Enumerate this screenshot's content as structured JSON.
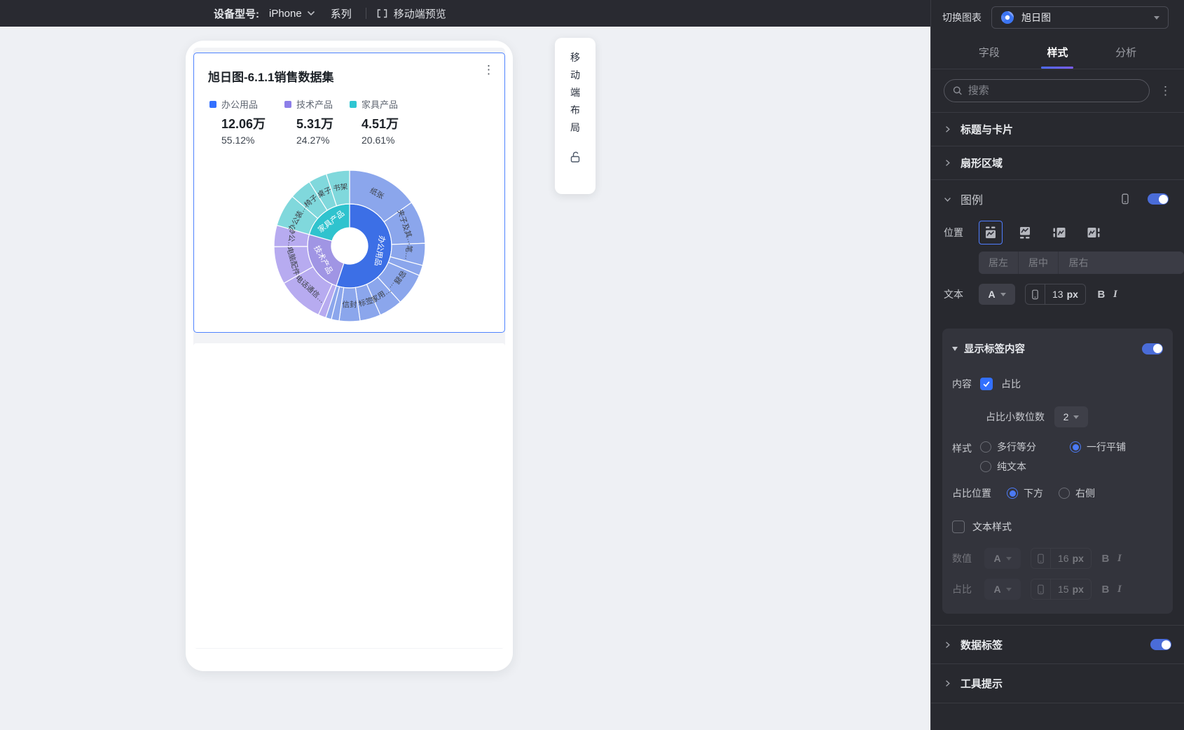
{
  "topbar": {
    "device_label": "设备型号:",
    "device_value": "iPhone",
    "series_label": "系列",
    "preview_label": "移动端预览"
  },
  "switcher": {
    "label": "切换图表",
    "value": "旭日图"
  },
  "tabs": [
    {
      "label": "字段"
    },
    {
      "label": "样式"
    },
    {
      "label": "分析"
    }
  ],
  "search": {
    "placeholder": "搜索"
  },
  "sections": {
    "title_card": "标题与卡片",
    "sector": "扇形区域",
    "legend": "图例",
    "data_label": "数据标签",
    "tooltip": "工具提示"
  },
  "controls": {
    "color_letter": "A",
    "bold": "B",
    "italic": "I",
    "px": "px"
  },
  "legend_panel": {
    "position_label": "位置",
    "align_options": [
      "居左",
      "居中",
      "居右"
    ],
    "text_label": "文本",
    "text_size": "13",
    "legend_enabled": true
  },
  "label_content": {
    "title": "显示标签内容",
    "enabled": true,
    "content_label": "内容",
    "content_option": "占比",
    "content_checked": true,
    "decimal_label": "占比小数位数",
    "decimal_value": "2",
    "style_label": "样式",
    "style_options": [
      {
        "label": "多行等分",
        "selected": false
      },
      {
        "label": "一行平铺",
        "selected": true
      },
      {
        "label": "纯文本",
        "selected": false
      }
    ],
    "percent_pos_label": "占比位置",
    "percent_pos_options": [
      {
        "label": "下方",
        "selected": true
      },
      {
        "label": "右侧",
        "selected": false
      }
    ],
    "text_style_label": "文本样式",
    "text_style_checked": false,
    "value_row": {
      "label": "数值",
      "size": "16"
    },
    "percent_row": {
      "label": "占比",
      "size": "15"
    }
  },
  "data_label_enabled": true,
  "mobile_panel": {
    "chars": [
      "移",
      "动",
      "端",
      "布",
      "局"
    ]
  },
  "card": {
    "title": "旭日图-6.1.1销售数据集"
  },
  "chart_data": {
    "type": "sunburst",
    "title": "旭日图-6.1.1销售数据集",
    "legend_position": "top",
    "categories": [
      {
        "name": "办公用品",
        "value": "12.06万",
        "percent": "55.12%",
        "angle": 198.4,
        "color": "#3C6FE6",
        "legend_color": "#3370FF",
        "child_color": "#8BA6EC",
        "children": [
          {
            "name": "纸张",
            "angle": 55
          },
          {
            "name": "夹子及其…",
            "angle": 33
          },
          {
            "name": "笔…",
            "angle": 17
          },
          {
            "name": "",
            "angle": 8
          },
          {
            "name": "容器…",
            "angle": 25
          },
          {
            "name": "家用…",
            "angle": 18
          },
          {
            "name": "标签",
            "angle": 16
          },
          {
            "name": "信封",
            "angle": 16
          },
          {
            "name": "",
            "angle": 6
          },
          {
            "name": "",
            "angle": 4.4
          }
        ]
      },
      {
        "name": "技术产品",
        "value": "5.31万",
        "percent": "24.27%",
        "angle": 87.4,
        "color": "#A095E4",
        "legend_color": "#8D7FE9",
        "child_color": "#B7ABF0",
        "children": [
          {
            "name": "",
            "angle": 6
          },
          {
            "name": "电话通信…",
            "angle": 36
          },
          {
            "name": "电脑配件",
            "angle": 29
          },
          {
            "name": "办公…",
            "angle": 16.4
          }
        ]
      },
      {
        "name": "家具产品",
        "value": "4.51万",
        "percent": "20.61%",
        "angle": 74.2,
        "color": "#2FC3CE",
        "legend_color": "#2FC6D2",
        "child_color": "#80D8DC",
        "children": [
          {
            "name": "办公装…",
            "angle": 25
          },
          {
            "name": "椅子",
            "angle": 17
          },
          {
            "name": "桌子",
            "angle": 14.2
          },
          {
            "name": "书架",
            "angle": 18
          }
        ]
      }
    ]
  }
}
